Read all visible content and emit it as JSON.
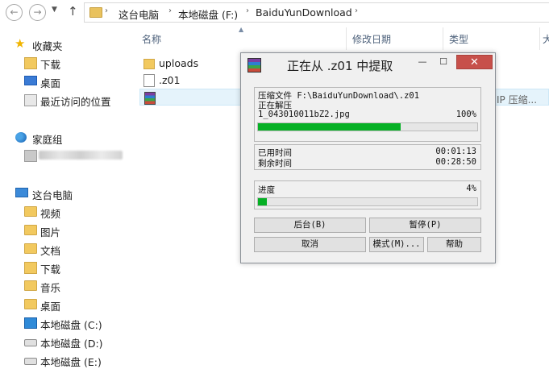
{
  "address_bar": {
    "crumbs": [
      "这台电脑",
      "本地磁盘 (F:)",
      "BaiduYunDownload"
    ]
  },
  "sidebar": {
    "favorites": "收藏夹",
    "downloads": "下载",
    "desktop": "桌面",
    "recent": "最近访问的位置",
    "homegroup": "家庭组",
    "this_pc": "这台电脑",
    "videos": "视频",
    "pictures": "图片",
    "documents": "文档",
    "downloads2": "下载",
    "music": "音乐",
    "desktop2": "桌面",
    "drive_c": "本地磁盘 (C:)",
    "drive_d": "本地磁盘 (D:)",
    "drive_e": "本地磁盘 (E:)"
  },
  "file_list": {
    "columns": [
      "名称",
      "修改日期",
      "类型",
      "大"
    ],
    "files": [
      {
        "name": "uploads",
        "icon": "folder-icon"
      },
      {
        "name": ".z01",
        "icon": "file-icon"
      },
      {
        "name": "",
        "icon": "rar-archive-icon"
      }
    ],
    "selected_type_fragment": "IP 压缩..."
  },
  "dialog": {
    "title": "正在从 .z01 中提取",
    "archive_label": "压缩文件 F:\\BaiduYunDownload\\.z01",
    "extracting_label": "正在解压",
    "current_file": "1_043010011bZ2.jpg",
    "file_percent_text": "100%",
    "file_progress": 0.65,
    "elapsed_label": "已用时间",
    "elapsed_value": "00:01:13",
    "remaining_label": "剩余时间",
    "remaining_value": "00:28:50",
    "progress_label": "进度",
    "progress_percent_text": "4%",
    "total_progress": 0.04,
    "buttons": {
      "background": "后台(B)",
      "pause": "暂停(P)",
      "cancel": "取消",
      "mode": "模式(M)...",
      "help": "帮助"
    },
    "colors": {
      "progress": "#06b025",
      "close": "#c7504a"
    }
  }
}
